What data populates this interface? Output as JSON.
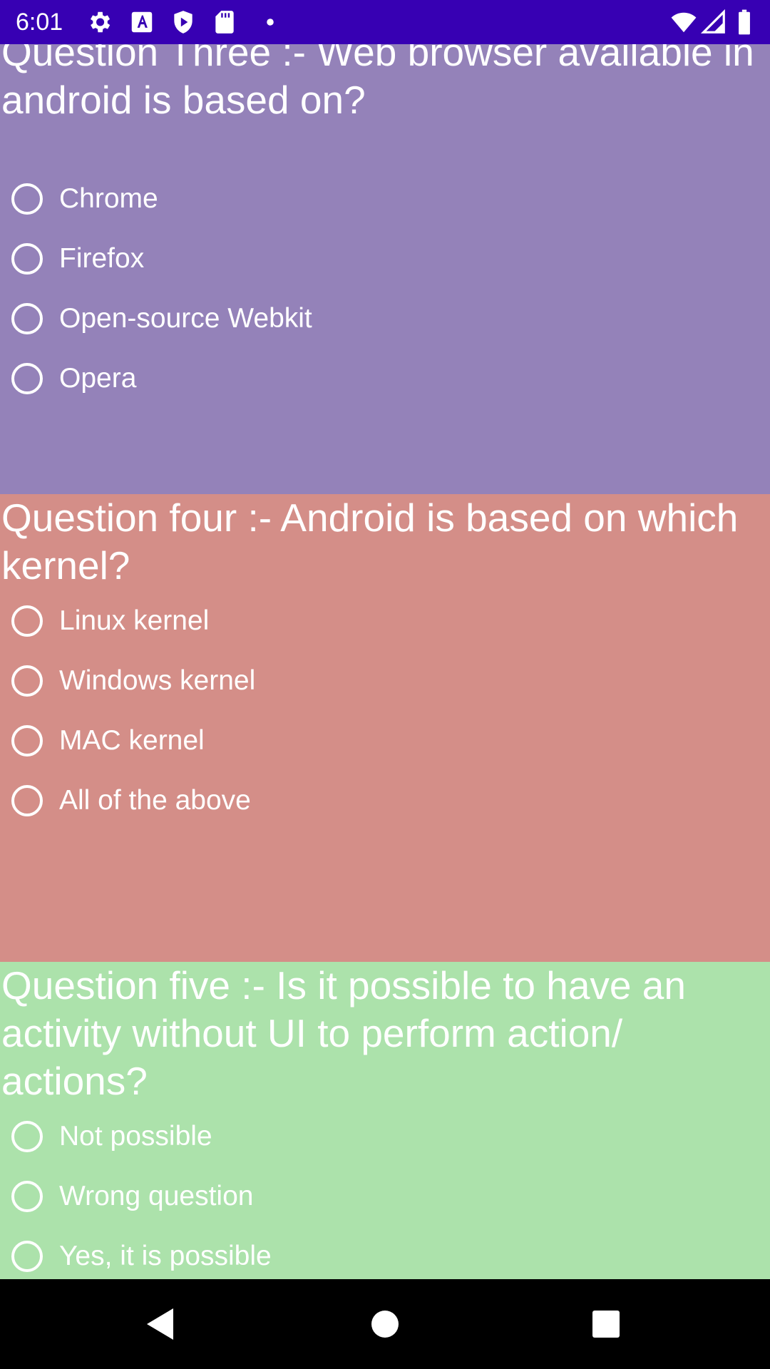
{
  "status_bar": {
    "time": "6:01",
    "background": "#3700b3",
    "left_icons": [
      "settings-icon",
      "font-icon",
      "shield-play-icon",
      "sd-card-icon",
      "notification-dot-icon"
    ],
    "right_icons": [
      "wifi-icon",
      "cellular-signal-icon",
      "battery-icon"
    ]
  },
  "questions": [
    {
      "text": "Question Three :- Web browser available in android is based on?",
      "background": "#9482b9",
      "options": [
        "Chrome",
        "Firefox",
        "Open-source Webkit",
        "Opera"
      ]
    },
    {
      "text": "Question four :- Android is based on which kernel?",
      "background": "#d48e88",
      "options": [
        "Linux kernel",
        "Windows kernel",
        "MAC kernel",
        "All of the above"
      ]
    },
    {
      "text": "Question five :- Is it possible to have an activity without UI to perform action/ actions?",
      "background": "#ace2ab",
      "options": [
        "Not possible",
        "Wrong question",
        "Yes, it is possible"
      ]
    }
  ],
  "nav_bar": {
    "buttons": [
      "back-icon",
      "home-icon",
      "recents-icon"
    ]
  }
}
